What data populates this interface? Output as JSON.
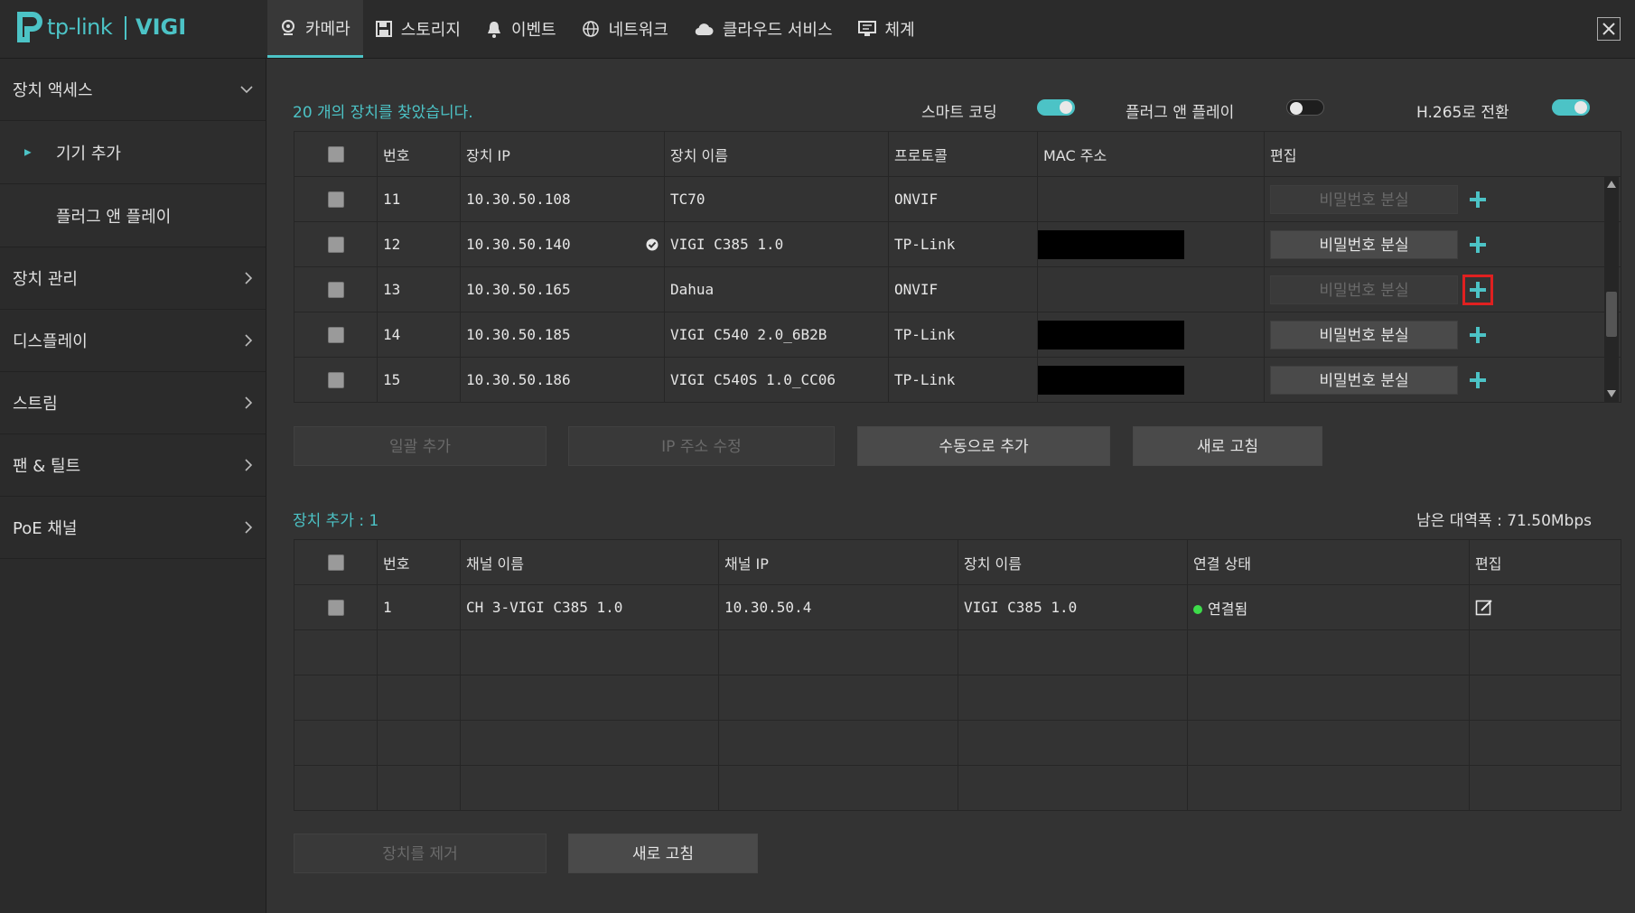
{
  "brand": {
    "name": "tp-link",
    "product": "VIGI"
  },
  "nav": {
    "tabs": [
      {
        "label": "카메라",
        "icon": "camera-icon",
        "active": true
      },
      {
        "label": "스토리지",
        "icon": "save-icon"
      },
      {
        "label": "이벤트",
        "icon": "bell-icon"
      },
      {
        "label": "네트워크",
        "icon": "globe-icon"
      },
      {
        "label": "클라우드 서비스",
        "icon": "cloud-icon"
      },
      {
        "label": "체계",
        "icon": "monitor-icon"
      }
    ]
  },
  "sidebar": {
    "items": [
      {
        "label": "장치 액세스",
        "expanded": true
      },
      {
        "label": "기기 추가",
        "sub": true,
        "active": true
      },
      {
        "label": "플러그 앤 플레이",
        "sub": true
      },
      {
        "label": "장치 관리"
      },
      {
        "label": "디스플레이"
      },
      {
        "label": "스트림"
      },
      {
        "label": "팬 & 틸트"
      },
      {
        "label": "PoE 채널"
      }
    ]
  },
  "search": {
    "found_text": "20 개의 장치를 찾았습니다.",
    "toggles": [
      {
        "label": "스마트 코딩",
        "on": true
      },
      {
        "label": "플러그 앤 플레이",
        "on": false
      },
      {
        "label": "H.265로 전환",
        "on": true
      }
    ]
  },
  "device_table": {
    "headers": [
      "번호",
      "장치 IP",
      "장치 이름",
      "프로토콜",
      "MAC 주소",
      "편집"
    ],
    "rows": [
      {
        "no": "11",
        "ip": "10.30.50.108",
        "name": "TC70",
        "protocol": "ONVIF",
        "mac_redacted": false,
        "pwd_enabled": false
      },
      {
        "no": "12",
        "ip": "10.30.50.140",
        "name": "VIGI C385 1.0",
        "protocol": "TP-Link",
        "mac_redacted": true,
        "pwd_enabled": true,
        "checked_icon": true
      },
      {
        "no": "13",
        "ip": "10.30.50.165",
        "name": "Dahua",
        "protocol": "ONVIF",
        "mac_redacted": false,
        "pwd_enabled": false,
        "highlight": true
      },
      {
        "no": "14",
        "ip": "10.30.50.185",
        "name": "VIGI C540 2.0_6B2B",
        "protocol": "TP-Link",
        "mac_redacted": true,
        "pwd_enabled": true
      },
      {
        "no": "15",
        "ip": "10.30.50.186",
        "name": "VIGI C540S 1.0_CC06",
        "protocol": "TP-Link",
        "mac_redacted": true,
        "pwd_enabled": true
      }
    ],
    "pwd_label": "비밀번호 분실"
  },
  "device_actions": {
    "batch_add": "일괄 추가",
    "edit_ip": "IP 주소 수정",
    "manual_add": "수동으로 추가",
    "refresh": "새로 고침"
  },
  "added": {
    "title": "장치 추가 : 1",
    "bandwidth": "남은 대역폭 : 71.50Mbps",
    "headers": [
      "번호",
      "채널 이름",
      "채널 IP",
      "장치 이름",
      "연결 상태",
      "편집"
    ],
    "rows": [
      {
        "no": "1",
        "channel_name": "CH 3-VIGI C385 1.0",
        "channel_ip": "10.30.50.4",
        "device_name": "VIGI C385 1.0",
        "status": "연결됨",
        "status_color": "#3ddc4a"
      }
    ],
    "empty_rows": 4
  },
  "added_actions": {
    "remove": "장치를 제거",
    "refresh": "새로 고침"
  },
  "colors": {
    "accent": "#4cc3c6",
    "highlight": "#e02020"
  }
}
